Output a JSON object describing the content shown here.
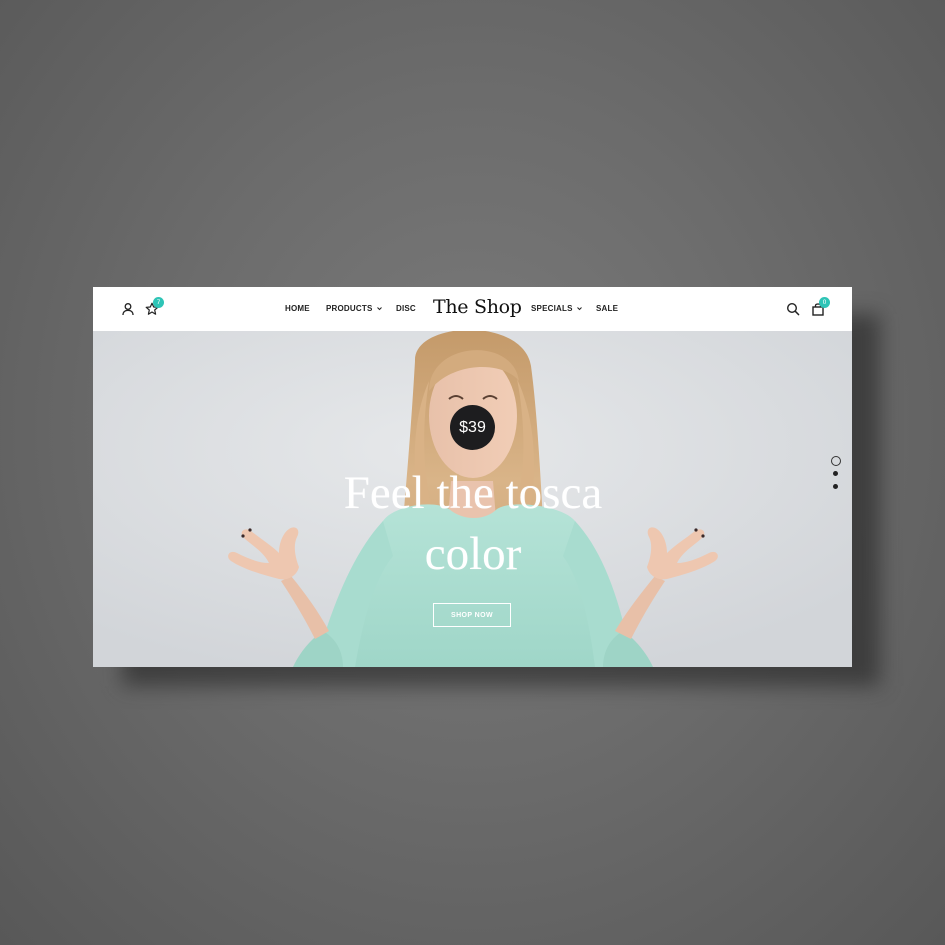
{
  "header": {
    "logo": "The Shop",
    "nav": [
      {
        "label": "HOME"
      },
      {
        "label": "PRODUCTS",
        "dropdown": true
      },
      {
        "label": "DISC"
      },
      {
        "label": "SPECIALS",
        "dropdown": true
      },
      {
        "label": "SALE"
      }
    ],
    "icons": {
      "account": "user-icon",
      "wishlist": "star-icon",
      "search": "search-icon",
      "cart": "shopping-bag-icon"
    },
    "wishlist_count": "7",
    "cart_count": "0"
  },
  "hero": {
    "price": "$39",
    "headline_line1": "Feel the tosca",
    "headline_line2": "color",
    "cta_label": "SHOP NOW",
    "slides": {
      "count": 3,
      "active_index": 0
    }
  },
  "colors": {
    "accent": "#2ec4b6",
    "page_background": "#6c6c6c",
    "price_badge": "#1d1d1f",
    "sweater": "#a9dccf"
  }
}
